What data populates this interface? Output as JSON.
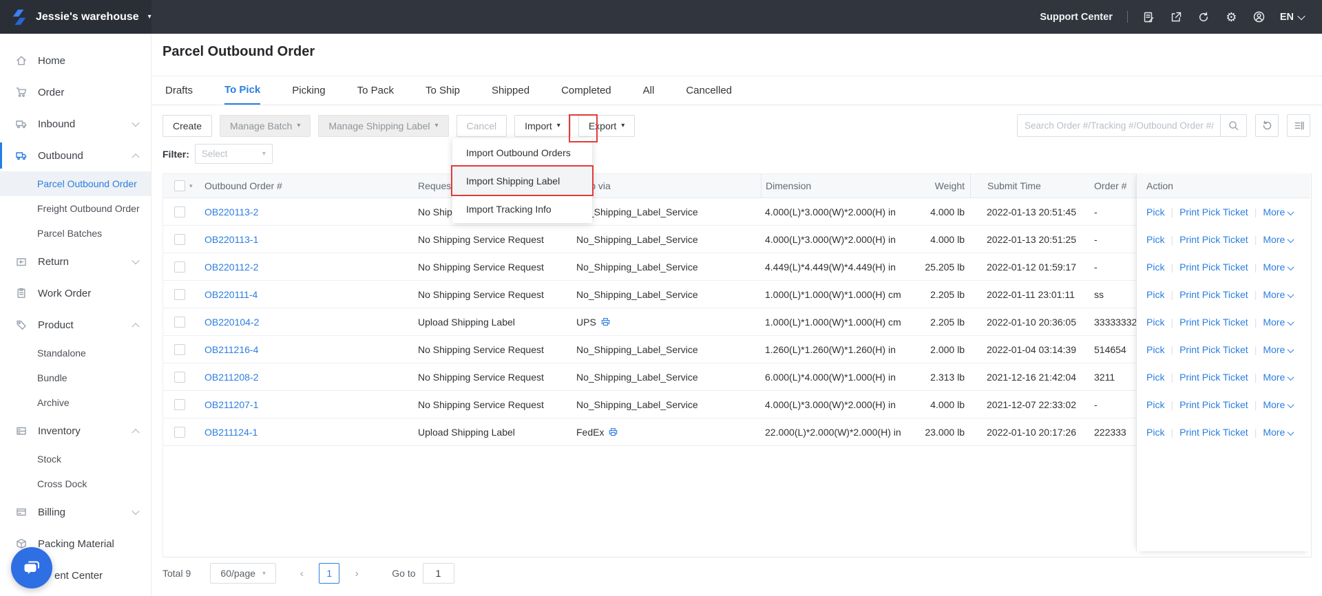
{
  "colors": {
    "accent": "#2a7de1",
    "annotation_red": "#e23b3b",
    "topbar": "#31353d"
  },
  "topbar": {
    "workspace": "Jessie's warehouse",
    "support_center": "Support Center",
    "locale": "EN",
    "icons": [
      "survey",
      "share",
      "refresh",
      "gear",
      "user"
    ]
  },
  "sidebar": {
    "items": [
      {
        "label": "Home",
        "icon": "home"
      },
      {
        "label": "Order",
        "icon": "cart"
      },
      {
        "label": "Inbound",
        "icon": "truck-in",
        "chevron": "down"
      },
      {
        "label": "Outbound",
        "icon": "truck-out",
        "chevron": "up",
        "active": true
      },
      {
        "label": "Parcel Outbound Order",
        "sub": true,
        "active": true
      },
      {
        "label": "Freight Outbound Order",
        "sub": true
      },
      {
        "label": "Parcel Batches",
        "sub": true
      },
      {
        "label": "Return",
        "icon": "return",
        "chevron": "down"
      },
      {
        "label": "Work Order",
        "icon": "clipboard"
      },
      {
        "label": "Product",
        "icon": "tag",
        "chevron": "up"
      },
      {
        "label": "Standalone",
        "sub": true
      },
      {
        "label": "Bundle",
        "sub": true
      },
      {
        "label": "Archive",
        "sub": true
      },
      {
        "label": "Inventory",
        "icon": "shelf",
        "chevron": "up"
      },
      {
        "label": "Stock",
        "sub": true
      },
      {
        "label": "Cross Dock",
        "sub": true
      },
      {
        "label": "Billing",
        "icon": "card",
        "chevron": "down"
      },
      {
        "label": "Packing Material",
        "icon": "box"
      },
      {
        "label": "ent Center",
        "icon": "doc",
        "covered": true
      }
    ]
  },
  "page": {
    "title": "Parcel Outbound Order"
  },
  "tabs": [
    "Drafts",
    "To Pick",
    "Picking",
    "To Pack",
    "To Ship",
    "Shipped",
    "Completed",
    "All",
    "Cancelled"
  ],
  "active_tab": 1,
  "toolbar": {
    "create": "Create",
    "manage_batch": "Manage Batch",
    "manage_shipping_label": "Manage Shipping Label",
    "cancel": "Cancel",
    "import": "Import",
    "export": "Export"
  },
  "search": {
    "placeholder": "Search Order #/Tracking #/Outbound Order #/SKU"
  },
  "filter": {
    "label": "Filter:",
    "placeholder": "Select"
  },
  "import_menu": {
    "items": [
      "Import Outbound Orders",
      "Import Shipping Label",
      "Import Tracking Info"
    ],
    "highlighted_index": 1
  },
  "table": {
    "columns": [
      "",
      "Outbound Order #",
      "Requested Service",
      "Ship via",
      "Dimension",
      "Weight",
      "Submit Time",
      "Order #",
      "Action"
    ],
    "rows": [
      {
        "id": "OB220113-2",
        "requested": "No Shipping Service Request",
        "ship_via": "No_Shipping_Label_Service",
        "printer": false,
        "dimension": "4.000(L)*3.000(W)*2.000(H) in",
        "weight": "4.000 lb",
        "submit": "2022-01-13 20:51:45",
        "order_no": "-"
      },
      {
        "id": "OB220113-1",
        "requested": "No Shipping Service Request",
        "ship_via": "No_Shipping_Label_Service",
        "printer": false,
        "dimension": "4.000(L)*3.000(W)*2.000(H) in",
        "weight": "4.000 lb",
        "submit": "2022-01-13 20:51:25",
        "order_no": "-"
      },
      {
        "id": "OB220112-2",
        "requested": "No Shipping Service Request",
        "ship_via": "No_Shipping_Label_Service",
        "printer": false,
        "dimension": "4.449(L)*4.449(W)*4.449(H) in",
        "weight": "25.205 lb",
        "submit": "2022-01-12 01:59:17",
        "order_no": "-"
      },
      {
        "id": "OB220111-4",
        "requested": "No Shipping Service Request",
        "ship_via": "No_Shipping_Label_Service",
        "printer": false,
        "dimension": "1.000(L)*1.000(W)*1.000(H) cm",
        "weight": "2.205 lb",
        "submit": "2022-01-11 23:01:11",
        "order_no": "ss"
      },
      {
        "id": "OB220104-2",
        "requested": "Upload Shipping Label",
        "ship_via": "UPS",
        "printer": true,
        "dimension": "1.000(L)*1.000(W)*1.000(H) cm",
        "weight": "2.205 lb",
        "submit": "2022-01-10 20:36:05",
        "order_no": "33333332"
      },
      {
        "id": "OB211216-4",
        "requested": "No Shipping Service Request",
        "ship_via": "No_Shipping_Label_Service",
        "printer": false,
        "dimension": "1.260(L)*1.260(W)*1.260(H) in",
        "weight": "2.000 lb",
        "submit": "2022-01-04 03:14:39",
        "order_no": "514654"
      },
      {
        "id": "OB211208-2",
        "requested": "No Shipping Service Request",
        "ship_via": "No_Shipping_Label_Service",
        "printer": false,
        "dimension": "6.000(L)*4.000(W)*1.000(H) in",
        "weight": "2.313 lb",
        "submit": "2021-12-16 21:42:04",
        "order_no": "3211"
      },
      {
        "id": "OB211207-1",
        "requested": "No Shipping Service Request",
        "ship_via": "No_Shipping_Label_Service",
        "printer": false,
        "dimension": "4.000(L)*3.000(W)*2.000(H) in",
        "weight": "4.000 lb",
        "submit": "2021-12-07 22:33:02",
        "order_no": "-"
      },
      {
        "id": "OB211124-1",
        "requested": "Upload Shipping Label",
        "ship_via": "FedEx",
        "printer": true,
        "dimension": "22.000(L)*2.000(W)*2.000(H) in",
        "weight": "23.000 lb",
        "submit": "2022-01-10 20:17:26",
        "order_no": "222333"
      }
    ]
  },
  "row_actions": {
    "pick": "Pick",
    "print": "Print Pick Ticket",
    "more": "More"
  },
  "pagination": {
    "total": "Total 9",
    "page_size": "60/page",
    "prev": "‹",
    "next": "›",
    "current": "1",
    "goto_label": "Go to",
    "goto_value": "1"
  }
}
